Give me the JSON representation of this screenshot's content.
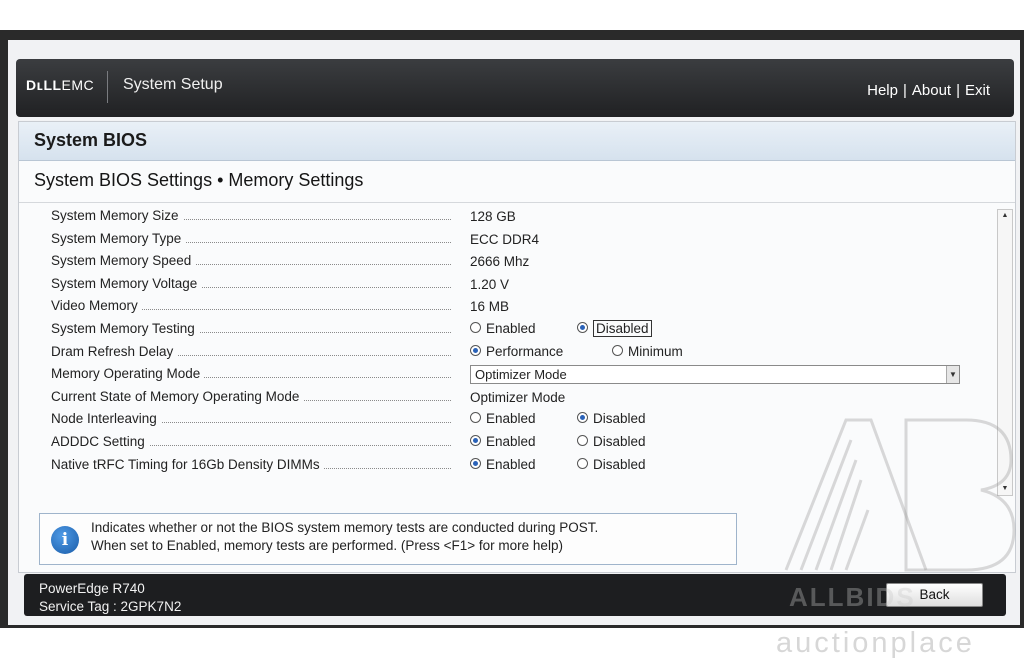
{
  "header": {
    "brand_left": "DʟLL",
    "brand_right": "EMC",
    "app_title": "System Setup",
    "links": [
      "Help",
      "About",
      "Exit"
    ],
    "separator": "|"
  },
  "section_title": "System BIOS",
  "page_title": "System BIOS Settings • Memory Settings",
  "settings": [
    {
      "label": "System Memory Size",
      "value": "128 GB"
    },
    {
      "label": "System Memory Type",
      "value": "ECC DDR4"
    },
    {
      "label": "System Memory Speed",
      "value": "2666 Mhz"
    },
    {
      "label": "System Memory Voltage",
      "value": "1.20 V"
    },
    {
      "label": "Video Memory",
      "value": "16 MB"
    },
    {
      "label": "System Memory Testing",
      "options": [
        "Enabled",
        "Disabled"
      ],
      "selected": "Disabled"
    },
    {
      "label": "Dram Refresh Delay",
      "options": [
        "Performance",
        "Minimum"
      ],
      "selected": "Performance"
    },
    {
      "label": "Memory Operating Mode",
      "select_value": "Optimizer Mode"
    },
    {
      "label": "Current State of Memory Operating Mode",
      "value": "Optimizer Mode"
    },
    {
      "label": "Node Interleaving",
      "options": [
        "Enabled",
        "Disabled"
      ],
      "selected": "Disabled"
    },
    {
      "label": "ADDDC Setting",
      "options": [
        "Enabled",
        "Disabled"
      ],
      "selected": "Enabled"
    },
    {
      "label": "Native tRFC Timing for 16Gb Density DIMMs",
      "options": [
        "Enabled",
        "Disabled"
      ],
      "selected": "Enabled"
    }
  ],
  "help": {
    "line1": "Indicates whether or not the BIOS system memory tests are conducted during POST.",
    "line2": "When set to Enabled, memory tests are performed. (Press <F1> for more help)"
  },
  "footer": {
    "model": "PowerEdge R740",
    "service_tag": "Service Tag : 2GPK7N2",
    "back_label": "Back"
  },
  "watermark": {
    "brand": "ALLBIDS",
    "sub": "auctionplace"
  },
  "colors": {
    "header_bg": "#2b2c2e",
    "section_bg": "#dbe6f1",
    "radio_on": "#2a62b8",
    "footer_bg": "#1d1e20"
  }
}
